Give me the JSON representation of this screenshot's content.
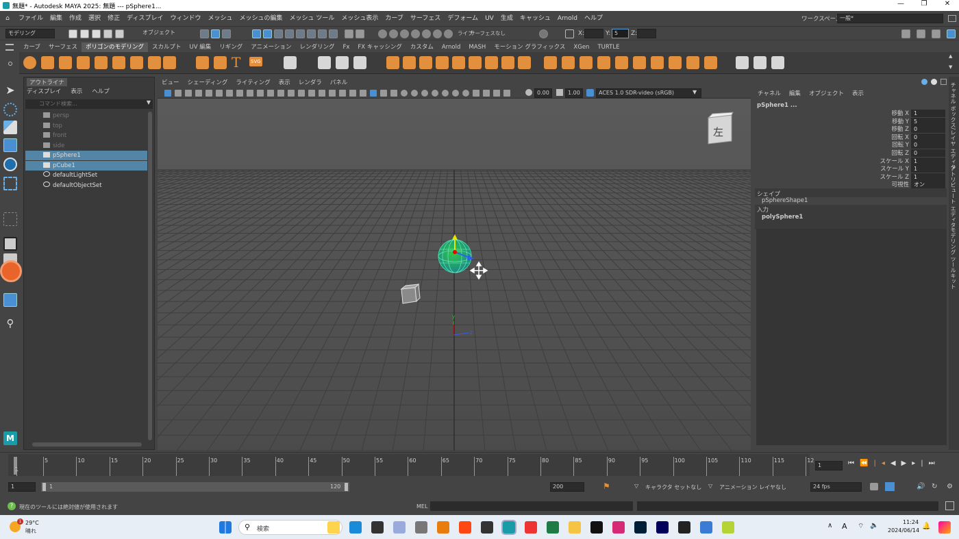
{
  "titlebar": {
    "title": "無題* - Autodesk MAYA 2025: 無題   ---   pSphere1..."
  },
  "menubar": {
    "items": [
      "ファイル",
      "編集",
      "作成",
      "選択",
      "修正",
      "ディスプレイ",
      "ウィンドウ",
      "メッシュ",
      "メッシュの編集",
      "メッシュ ツール",
      "メッシュ表示",
      "カーブ",
      "サーフェス",
      "デフォーム",
      "UV",
      "生成",
      "キャッシュ",
      "Arnold",
      "ヘルプ"
    ],
    "workspace_label": "ワークスペース:",
    "workspace_value": "一般*"
  },
  "statusline": {
    "mode": "モデリング",
    "object_field": "オブジェクト",
    "live": "ライブ",
    "live_surface": "サーフェスなし",
    "x_label": "X:",
    "y_label": "Y:",
    "z_label": "Z:",
    "y_value": "5"
  },
  "shelf": {
    "tabs": [
      "カーブ",
      "サーフェス",
      "ポリゴンのモデリング",
      "スカルプト",
      "UV 編集",
      "リギング",
      "アニメーション",
      "レンダリング",
      "Fx",
      "FX キャッシング",
      "カスタム",
      "Arnold",
      "MASH",
      "モーション グラフィックス",
      "XGen",
      "TURTLE"
    ],
    "active_tab": "ポリゴンのモデリング",
    "text_icon": "T",
    "svg_icon": "SVG"
  },
  "outliner": {
    "title": "アウトライナ",
    "menu": [
      "ディスプレイ",
      "表示",
      "ヘルプ"
    ],
    "search_placeholder": "コマンド検索...",
    "items": [
      {
        "label": "persp",
        "selected": false,
        "dim": true,
        "icon": "camera-icon"
      },
      {
        "label": "top",
        "selected": false,
        "dim": true,
        "icon": "camera-icon"
      },
      {
        "label": "front",
        "selected": false,
        "dim": true,
        "icon": "camera-icon"
      },
      {
        "label": "side",
        "selected": false,
        "dim": true,
        "icon": "camera-icon"
      },
      {
        "label": "pSphere1",
        "selected": true,
        "dim": false,
        "icon": "mesh-icon"
      },
      {
        "label": "pCube1",
        "selected": true,
        "dim": false,
        "icon": "mesh-icon"
      },
      {
        "label": "defaultLightSet",
        "selected": false,
        "dim": false,
        "icon": "set-icon"
      },
      {
        "label": "defaultObjectSet",
        "selected": false,
        "dim": false,
        "icon": "set-icon"
      }
    ]
  },
  "viewport": {
    "menu": [
      "ビュー",
      "シェーディング",
      "ライティング",
      "表示",
      "レンダラ",
      "パネル"
    ],
    "exposure": "0.00",
    "gamma": "1.00",
    "colorspace": "ACES 1.0 SDR-video (sRGB)",
    "viewcube_label": "左",
    "axis_y": "y",
    "axis_z": "z"
  },
  "channelbox": {
    "menu": [
      "チャネル",
      "編集",
      "オブジェクト",
      "表示"
    ],
    "object_name": "pSphere1 ...",
    "attributes": [
      {
        "name": "移動 X",
        "value": "1"
      },
      {
        "name": "移動 Y",
        "value": "5"
      },
      {
        "name": "移動 Z",
        "value": "0"
      },
      {
        "name": "回転 X",
        "value": "0"
      },
      {
        "name": "回転 Y",
        "value": "0"
      },
      {
        "name": "回転 Z",
        "value": "0"
      },
      {
        "name": "スケール X",
        "value": "1"
      },
      {
        "name": "スケール Y",
        "value": "1"
      },
      {
        "name": "スケール Z",
        "value": "1"
      },
      {
        "name": "可視性",
        "value": "オン"
      }
    ],
    "shapes_label": "シェイプ",
    "shape_name": "pSphereShape1",
    "inputs_label": "入力",
    "input_name": "polySphere1"
  },
  "sidetabs": [
    "チャネル ボックス/レイヤ エディタ",
    "アトリビュート エディタ",
    "モデリング ツールキット"
  ],
  "timeslider": {
    "ticks": [
      "5",
      "10",
      "15",
      "20",
      "25",
      "30",
      "35",
      "40",
      "45",
      "50",
      "55",
      "60",
      "65",
      "70",
      "75",
      "80",
      "85",
      "90",
      "95",
      "100",
      "105",
      "110",
      "115",
      "12"
    ],
    "start_label": "1",
    "current_frame": "1"
  },
  "rangeslider": {
    "start": "1",
    "inner_start": "1",
    "inner_end": "120",
    "end": "200",
    "character_set": "キャラクタ セットなし",
    "anim_layer": "アニメーション レイヤなし",
    "fps": "24 fps"
  },
  "cmdline": {
    "help_text": "現在のツールには絶対値が使用されます",
    "mel_label": "MEL"
  },
  "taskbar": {
    "temperature": "29°C",
    "weather": "晴れ",
    "weather_badge": "1",
    "search_placeholder": "検索",
    "time": "11:24",
    "date": "2024/06/14",
    "ime": "A"
  }
}
